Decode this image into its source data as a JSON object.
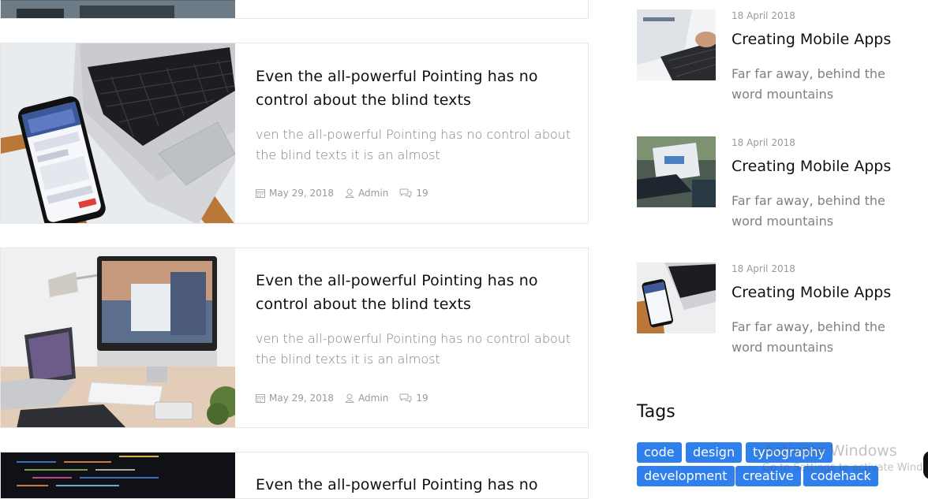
{
  "posts": [
    {
      "title": "Even the all-powerful Pointing has no control about the blind texts",
      "excerpt": "ven the all-powerful Pointing has no control about the blind texts it is an almost",
      "date": "May 29, 2018",
      "author": "Admin",
      "comments": "19"
    },
    {
      "title": "Even the all-powerful Pointing has no control about the blind texts",
      "excerpt": "ven the all-powerful Pointing has no control about the blind texts it is an almost",
      "date": "May 29, 2018",
      "author": "Admin",
      "comments": "19"
    },
    {
      "title": "Even the all-powerful Pointing has no"
    }
  ],
  "recent_posts": [
    {
      "date": "18 April 2018",
      "title": "Creating Mobile Apps",
      "desc": "Far far away, behind the word mountains"
    },
    {
      "date": "18 April 2018",
      "title": "Creating Mobile Apps",
      "desc": "Far far away, behind the word mountains"
    },
    {
      "date": "18 April 2018",
      "title": "Creating Mobile Apps",
      "desc": "Far far away, behind the word mountains"
    }
  ],
  "tags": {
    "title": "Tags",
    "items": [
      "code",
      "design",
      "typography",
      "development",
      "creative",
      "codehack"
    ]
  },
  "watermark": {
    "line1": "Activate Windows",
    "line2": "Go to Settings to activate Windows."
  },
  "colors": {
    "tag_bg": "#2f80ed",
    "muted_text": "#808080"
  }
}
